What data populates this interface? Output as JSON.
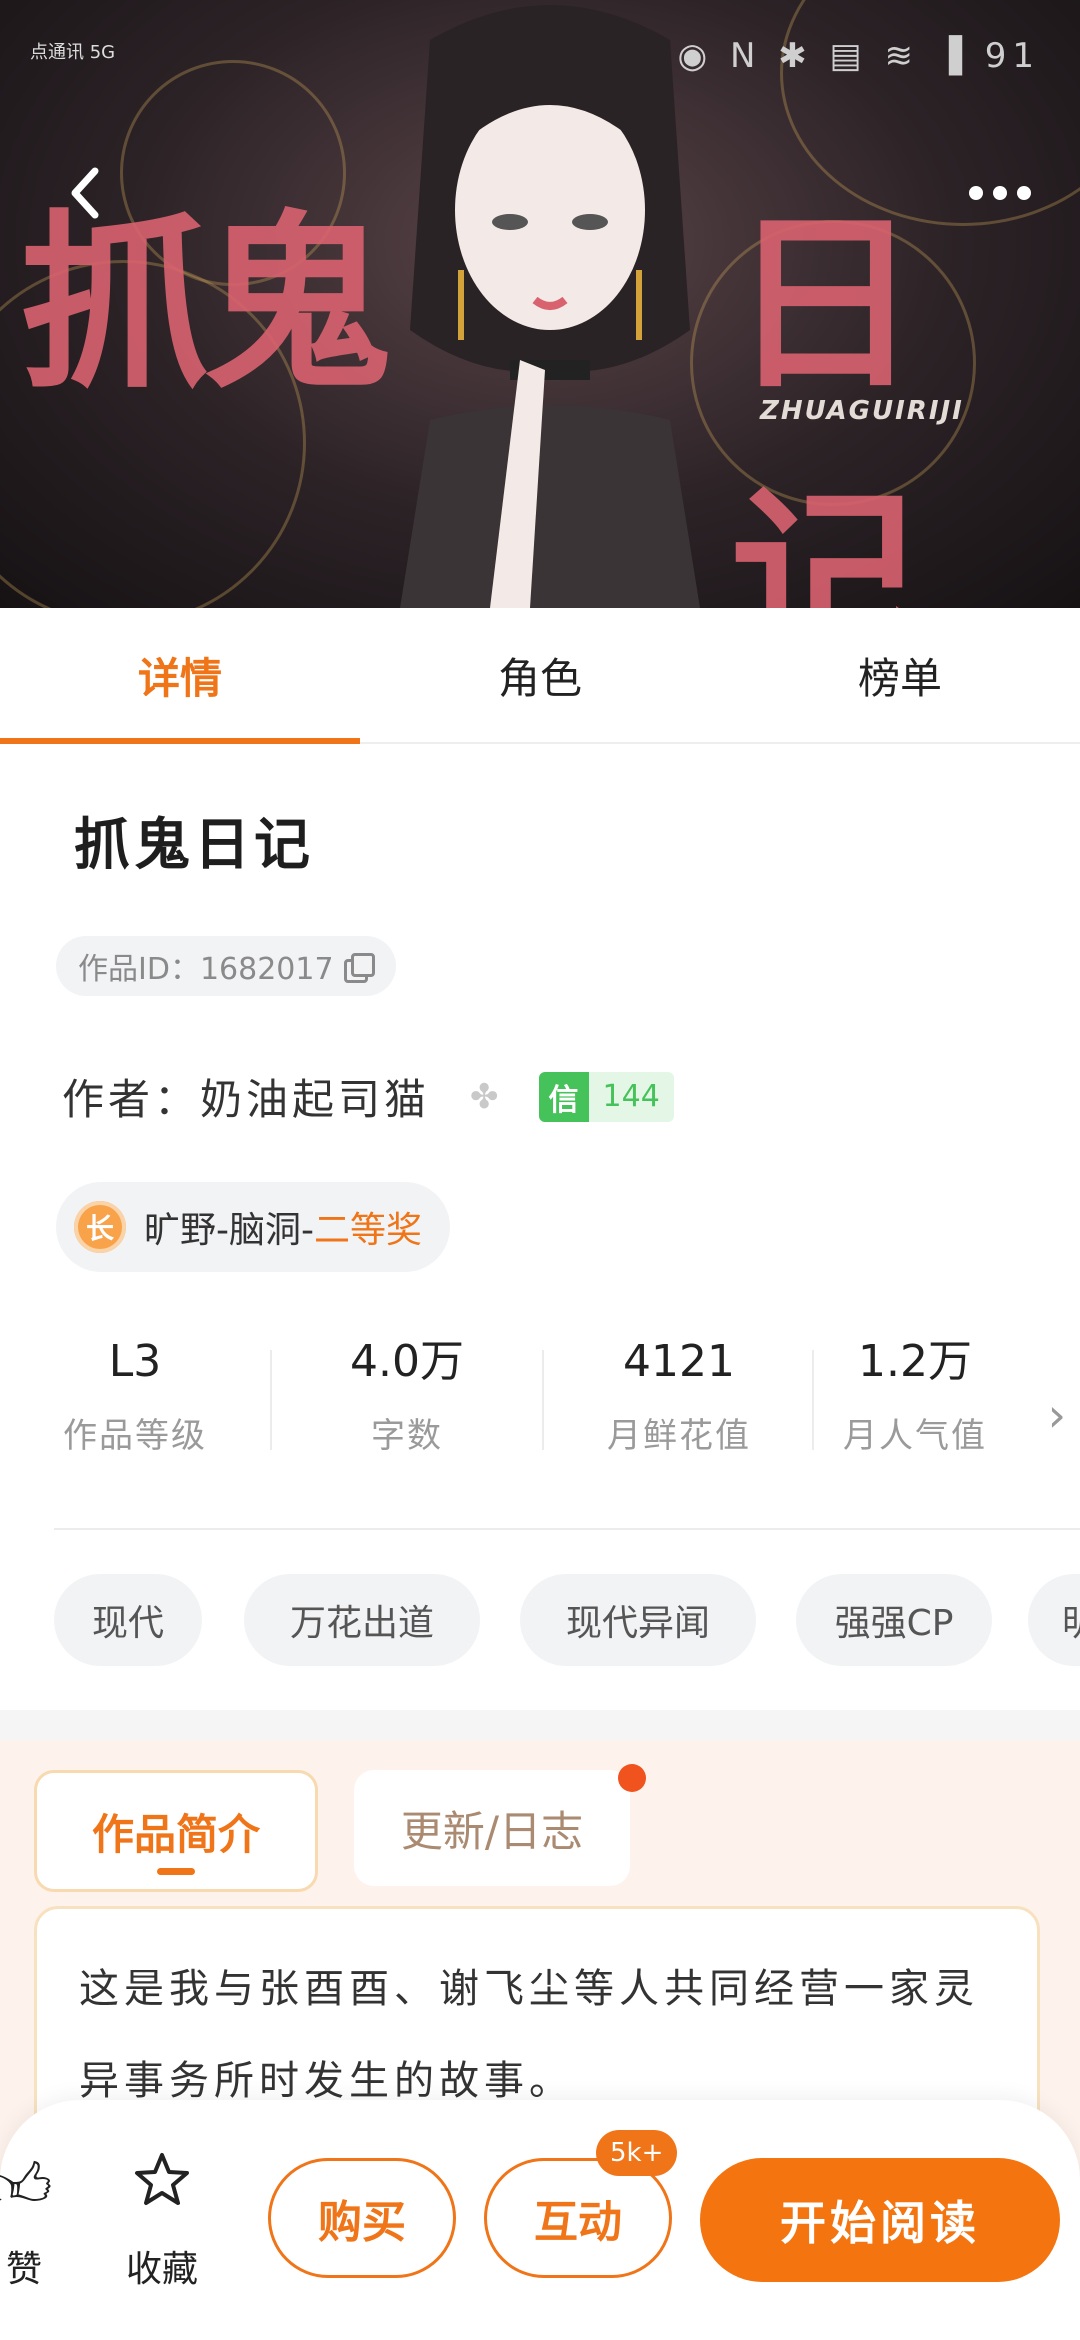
{
  "status_bar": {
    "left_text": "点通讯 5G",
    "right_icons": "◉ N ✱ ▤ ≋ ▐ 91",
    "battery": "91"
  },
  "banner": {
    "art_title": "抓鬼日记",
    "art_subtitle": "ZHUAGUIRIJI"
  },
  "tabs": [
    {
      "label": "详情",
      "active": true
    },
    {
      "label": "角色",
      "active": false
    },
    {
      "label": "榜单",
      "active": false
    }
  ],
  "work": {
    "title": "抓鬼日记",
    "id_text": "作品ID：1682017",
    "author_label": "作者：",
    "author_name": "奶油起司猫",
    "xin_label": "信",
    "xin_value": "144",
    "award_icon_text": "长",
    "award_prefix": "旷野-脑洞-",
    "award_highlight": "二等奖"
  },
  "stats": [
    {
      "value": "L3",
      "label": "作品等级"
    },
    {
      "value": "4.0万",
      "label": "字数"
    },
    {
      "value": "4121",
      "label": "月鲜花值"
    },
    {
      "value": "1.2万",
      "label": "月人气值"
    }
  ],
  "tags": [
    "现代",
    "万花出道",
    "现代异闻",
    "强强CP",
    "明"
  ],
  "intro": {
    "tab_active": "作品简介",
    "tab_inactive": "更新/日志",
    "text": "这是我与张酉酉、谢飞尘等人共同经营一家灵异事务所时发生的故事。"
  },
  "bottom_bar": {
    "like_label": "赞",
    "favorite_label": "收藏",
    "buy_label": "购买",
    "interact_label": "互动",
    "interact_badge": "5k+",
    "read_label": "开始阅读"
  },
  "colors": {
    "accent": "#f07418",
    "xin_green": "#46c25a",
    "intro_bg": "#fdf3ec"
  }
}
